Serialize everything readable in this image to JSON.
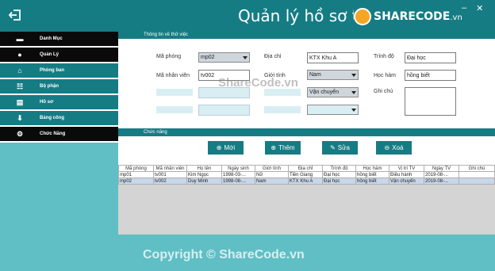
{
  "header": {
    "title": "Quản lý hồ sơ thử việc",
    "logo_text": "SHARECODE",
    "logo_suffix": ".vn",
    "min": "–",
    "close": "✕"
  },
  "sidebar": {
    "items": [
      {
        "label": "Danh Mục",
        "icon": "folder-icon"
      },
      {
        "label": "Quản Lý",
        "icon": "user-icon"
      },
      {
        "label": "Phòng ban",
        "icon": "home-icon"
      },
      {
        "label": "Bộ phận",
        "icon": "org-icon"
      },
      {
        "label": "Hồ sơ",
        "icon": "doc-icon"
      },
      {
        "label": "Bảng công",
        "icon": "download-icon"
      },
      {
        "label": "Chức Năng",
        "icon": "gear-icon"
      }
    ]
  },
  "info": {
    "section_title": "Thông tin về thử việc",
    "ma_phong_label": "Mã phòng",
    "ma_phong_value": "mp02",
    "ma_nv_label": "Mã nhân viên",
    "ma_nv_value": "tv002",
    "dia_chi_label": "Địa chỉ",
    "dia_chi_value": "KTX Khu A",
    "gioi_tinh_label": "Giới tính",
    "gioi_tinh_value": "Nam",
    "trinh_do_label": "Trình độ",
    "trinh_do_value": "Đại học",
    "hoc_ham_label": "Học hàm",
    "hoc_ham_value": "hồng biết",
    "vi_tri_value": "Vận chuyển",
    "ghi_chu_label": "Ghi chú"
  },
  "functions": {
    "section_title": "Chức năng",
    "new": "Mới",
    "add": "Thêm",
    "edit": "Sửa",
    "delete": "Xoá"
  },
  "table": {
    "columns": [
      "Mã phòng",
      "Mã nhân viên",
      "Họ tên",
      "Ngày sinh",
      "Giới tính",
      "Địa chỉ",
      "Trình độ",
      "Học hàm",
      "Vị trí TV",
      "Ngày TV",
      "Ghi chú"
    ],
    "rows": [
      [
        "mp01",
        "tv001",
        "Kim Ngọc",
        "1998-03-...",
        "Nữ",
        "Tiền Giang",
        "Đại học",
        "hồng biết",
        "Điều hành",
        "2019-08-...",
        ""
      ],
      [
        "mp02",
        "tv002",
        "Duy Minh",
        "1998-08-...",
        "Nam",
        "KTX Khu A",
        "Đại học",
        "hồng biết",
        "Vận chuyển",
        "2019-08-...",
        ""
      ]
    ]
  },
  "watermark": {
    "center": "ShareCode.vn",
    "bottom": "Copyright © ShareCode.vn"
  },
  "colors": {
    "primary": "#157c84",
    "background": "#5fbfc5",
    "sidebar_dark": "#0a0a0a"
  }
}
